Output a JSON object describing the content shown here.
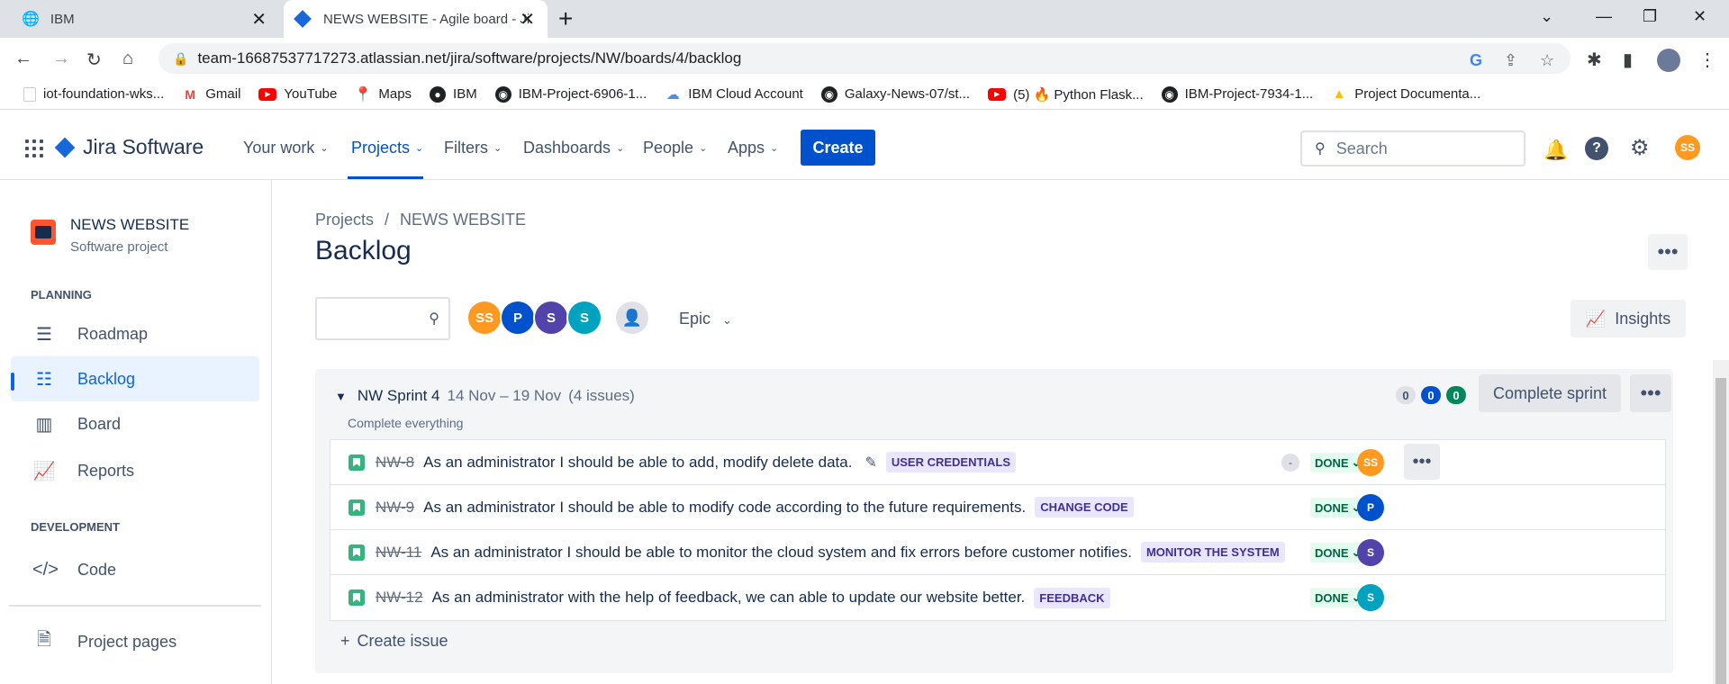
{
  "browser": {
    "tabs": [
      {
        "title": "IBM",
        "icon": "globe-icon"
      },
      {
        "title": "NEWS WEBSITE - Agile board - Ji",
        "icon": "jira-icon"
      }
    ],
    "url": "team-16687537717273.atlassian.net/jira/software/projects/NW/boards/4/backlog",
    "bookmarks": [
      {
        "label": "iot-foundation-wks...",
        "icon": "page-icon"
      },
      {
        "label": "Gmail",
        "icon": "gmail-icon"
      },
      {
        "label": "YouTube",
        "icon": "youtube-icon"
      },
      {
        "label": "Maps",
        "icon": "maps-icon"
      },
      {
        "label": "IBM",
        "icon": "globe-icon"
      },
      {
        "label": "IBM-Project-6906-1...",
        "icon": "github-icon"
      },
      {
        "label": "IBM Cloud Account",
        "icon": "cloud-icon"
      },
      {
        "label": "Galaxy-News-07/st...",
        "icon": "github-icon"
      },
      {
        "label": "(5) 🔥 Python Flask...",
        "icon": "youtube-icon"
      },
      {
        "label": "IBM-Project-7934-1...",
        "icon": "github-icon"
      },
      {
        "label": "Project Documenta...",
        "icon": "drive-icon"
      }
    ]
  },
  "topnav": {
    "product": "Jira Software",
    "items": [
      "Your work",
      "Projects",
      "Filters",
      "Dashboards",
      "People",
      "Apps"
    ],
    "create": "Create",
    "search_placeholder": "Search",
    "user_initials": "SS"
  },
  "sidebar": {
    "project_name": "NEWS WEBSITE",
    "project_type": "Software project",
    "planning_title": "PLANNING",
    "planning_items": [
      "Roadmap",
      "Backlog",
      "Board",
      "Reports"
    ],
    "development_title": "DEVELOPMENT",
    "development_items": [
      "Code"
    ],
    "other_items": [
      "Project pages"
    ]
  },
  "main": {
    "breadcrumb": [
      "Projects",
      "NEWS WEBSITE"
    ],
    "title": "Backlog",
    "avatars": [
      {
        "initials": "SS",
        "color": "#ff991f"
      },
      {
        "initials": "P",
        "color": "#0052cc"
      },
      {
        "initials": "S",
        "color": "#5243aa"
      },
      {
        "initials": "S",
        "color": "#00a3bf"
      }
    ],
    "epic_filter": "Epic",
    "insights": "Insights"
  },
  "sprint": {
    "name": "NW Sprint 4",
    "dates": "14 Nov – 19 Nov",
    "issue_count": "(4 issues)",
    "goal": "Complete everything",
    "counts": {
      "todo": "0",
      "in_progress": "0",
      "done": "0"
    },
    "complete_button": "Complete sprint",
    "issues": [
      {
        "key": "NW-8",
        "summary": "As an administrator I should be able to add, modify delete data.",
        "label": "USER CREDENTIALS",
        "status": "DONE",
        "assignee": "SS",
        "assignee_color": "#ff991f",
        "estimate": "-"
      },
      {
        "key": "NW-9",
        "summary": "As an administrator I should be able to modify code according to the future requirements.",
        "label": "CHANGE CODE",
        "status": "DONE",
        "assignee": "P",
        "assignee_color": "#0052cc"
      },
      {
        "key": "NW-11",
        "summary": "As an administrator I should be able to monitor the cloud system and fix errors before customer notifies.",
        "label": "MONITOR THE SYSTEM",
        "status": "DONE",
        "assignee": "S",
        "assignee_color": "#5243aa"
      },
      {
        "key": "NW-12",
        "summary": "As an administrator with the help of feedback, we can able to update our website better.",
        "label": "FEEDBACK",
        "status": "DONE",
        "assignee": "S",
        "assignee_color": "#00a3bf"
      }
    ],
    "create_issue": "Create issue"
  }
}
